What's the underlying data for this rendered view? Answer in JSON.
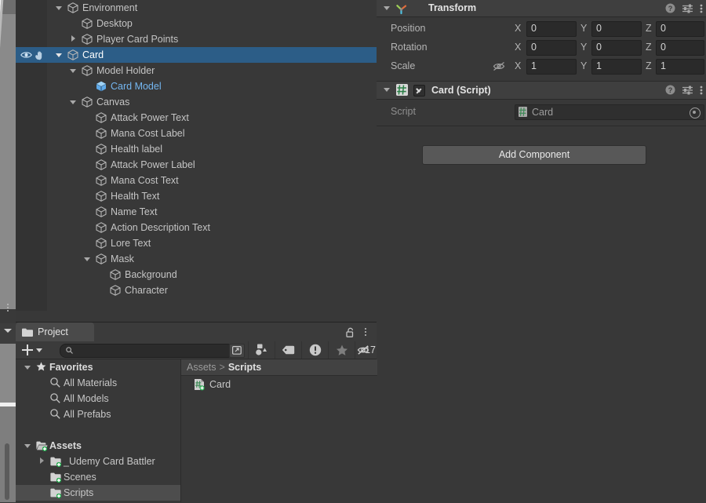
{
  "theme": {
    "bg": "#383838",
    "panel_header": "#3f3f3f",
    "selection_blue": "#2c5d87",
    "selection_gray": "#4d4d4d",
    "prefab_blue": "#74b6f0",
    "field_bg": "#2a2a2a",
    "text": "#c4c4c4",
    "green_accent": "#1ea84a"
  },
  "hierarchy": {
    "rows": [
      {
        "label": "Environment",
        "depth": 2,
        "foldout": "open",
        "icon": "gameobject-icon",
        "selected": false,
        "prefab": false
      },
      {
        "label": "Desktop",
        "depth": 3,
        "foldout": "none",
        "icon": "gameobject-icon",
        "selected": false,
        "prefab": false
      },
      {
        "label": "Player Card Points",
        "depth": 3,
        "foldout": "closed",
        "icon": "gameobject-icon",
        "selected": false,
        "prefab": false
      },
      {
        "label": "Card",
        "depth": 2,
        "foldout": "open",
        "icon": "gameobject-icon",
        "selected": true,
        "prefab": false
      },
      {
        "label": "Model Holder",
        "depth": 3,
        "foldout": "open",
        "icon": "gameobject-icon",
        "selected": false,
        "prefab": false
      },
      {
        "label": "Card Model",
        "depth": 4,
        "foldout": "none",
        "icon": "prefab-icon",
        "selected": false,
        "prefab": true
      },
      {
        "label": "Canvas",
        "depth": 3,
        "foldout": "open",
        "icon": "gameobject-icon",
        "selected": false,
        "prefab": false
      },
      {
        "label": "Attack Power Text",
        "depth": 4,
        "foldout": "none",
        "icon": "gameobject-icon",
        "selected": false,
        "prefab": false
      },
      {
        "label": "Mana Cost Label",
        "depth": 4,
        "foldout": "none",
        "icon": "gameobject-icon",
        "selected": false,
        "prefab": false
      },
      {
        "label": "Health label",
        "depth": 4,
        "foldout": "none",
        "icon": "gameobject-icon",
        "selected": false,
        "prefab": false
      },
      {
        "label": "Attack Power Label",
        "depth": 4,
        "foldout": "none",
        "icon": "gameobject-icon",
        "selected": false,
        "prefab": false
      },
      {
        "label": "Mana Cost Text",
        "depth": 4,
        "foldout": "none",
        "icon": "gameobject-icon",
        "selected": false,
        "prefab": false
      },
      {
        "label": "Health Text",
        "depth": 4,
        "foldout": "none",
        "icon": "gameobject-icon",
        "selected": false,
        "prefab": false
      },
      {
        "label": "Name Text",
        "depth": 4,
        "foldout": "none",
        "icon": "gameobject-icon",
        "selected": false,
        "prefab": false
      },
      {
        "label": "Action Description Text",
        "depth": 4,
        "foldout": "none",
        "icon": "gameobject-icon",
        "selected": false,
        "prefab": false
      },
      {
        "label": "Lore Text",
        "depth": 4,
        "foldout": "none",
        "icon": "gameobject-icon",
        "selected": false,
        "prefab": false
      },
      {
        "label": "Mask",
        "depth": 4,
        "foldout": "open",
        "icon": "gameobject-icon",
        "selected": false,
        "prefab": false
      },
      {
        "label": "Background",
        "depth": 5,
        "foldout": "none",
        "icon": "gameobject-icon",
        "selected": false,
        "prefab": false
      },
      {
        "label": "Character",
        "depth": 5,
        "foldout": "none",
        "icon": "gameobject-icon",
        "selected": false,
        "prefab": false
      }
    ],
    "selected_row_icons": [
      "eye-icon",
      "pointer-hand-icon"
    ]
  },
  "inspector": {
    "transform": {
      "title": "Transform",
      "icon": "transform-axis-icon",
      "header_icons": [
        "help-icon",
        "preset-icon",
        "more-menu-icon"
      ],
      "rows": [
        {
          "label": "Position",
          "x": "0",
          "y": "0",
          "z": "0",
          "extra_icon": ""
        },
        {
          "label": "Rotation",
          "x": "0",
          "y": "0",
          "z": "0",
          "extra_icon": ""
        },
        {
          "label": "Scale",
          "x": "1",
          "y": "1",
          "z": "1",
          "extra_icon": "constrain-proportions-off-icon"
        }
      ],
      "axis_labels": [
        "X",
        "Y",
        "Z"
      ]
    },
    "card_script": {
      "title": "Card (Script)",
      "icon": "cs-script-icon",
      "enabled": true,
      "header_icons": [
        "help-icon",
        "preset-icon",
        "more-menu-icon"
      ],
      "script_label": "Script",
      "script_value": "Card",
      "script_value_icon": "cs-script-icon",
      "object_picker_icon": "object-picker-icon"
    },
    "add_component_label": "Add Component"
  },
  "project": {
    "tab_label": "Project",
    "tab_icon": "folder-icon",
    "lock_icon": "lock-open-icon",
    "menu_icon": "more-menu-icon",
    "toolbar": {
      "create_label": "+",
      "search_placeholder": "",
      "search_value": "",
      "search_icon": "search-icon",
      "expand_icon": "expand-search-icon",
      "filter_icons": [
        "filter-by-type-icon",
        "filter-by-label-icon",
        "filter-warnings-icon",
        "filter-favorites-icon"
      ],
      "hidden_count_icon": "hidden-items-icon",
      "hidden_count": "17"
    },
    "tree": [
      {
        "label": "Favorites",
        "depth": 0,
        "foldout": "open",
        "icon": "star-icon",
        "bold": true,
        "selected": false
      },
      {
        "label": "All Materials",
        "depth": 1,
        "foldout": "none",
        "icon": "saved-search-icon",
        "bold": false,
        "selected": false
      },
      {
        "label": "All Models",
        "depth": 1,
        "foldout": "none",
        "icon": "saved-search-icon",
        "bold": false,
        "selected": false
      },
      {
        "label": "All Prefabs",
        "depth": 1,
        "foldout": "none",
        "icon": "saved-search-icon",
        "bold": false,
        "selected": false
      },
      {
        "label": "",
        "depth": 0,
        "foldout": "none",
        "icon": "",
        "bold": false,
        "selected": false
      },
      {
        "label": "Assets",
        "depth": 0,
        "foldout": "open",
        "icon": "folder-vcs-icon",
        "bold": true,
        "selected": false
      },
      {
        "label": "_Udemy Card Battler",
        "depth": 1,
        "foldout": "closed",
        "icon": "folder-vcs-icon",
        "bold": false,
        "selected": false
      },
      {
        "label": "Scenes",
        "depth": 1,
        "foldout": "none",
        "icon": "folder-vcs-icon",
        "bold": false,
        "selected": false
      },
      {
        "label": "Scripts",
        "depth": 1,
        "foldout": "none",
        "icon": "folder-vcs-icon",
        "bold": false,
        "selected": true
      }
    ],
    "breadcrumb": {
      "root": "Assets",
      "separator": ">",
      "current": "Scripts"
    },
    "items": [
      {
        "label": "Card",
        "icon": "cs-script-vcs-icon"
      }
    ]
  }
}
